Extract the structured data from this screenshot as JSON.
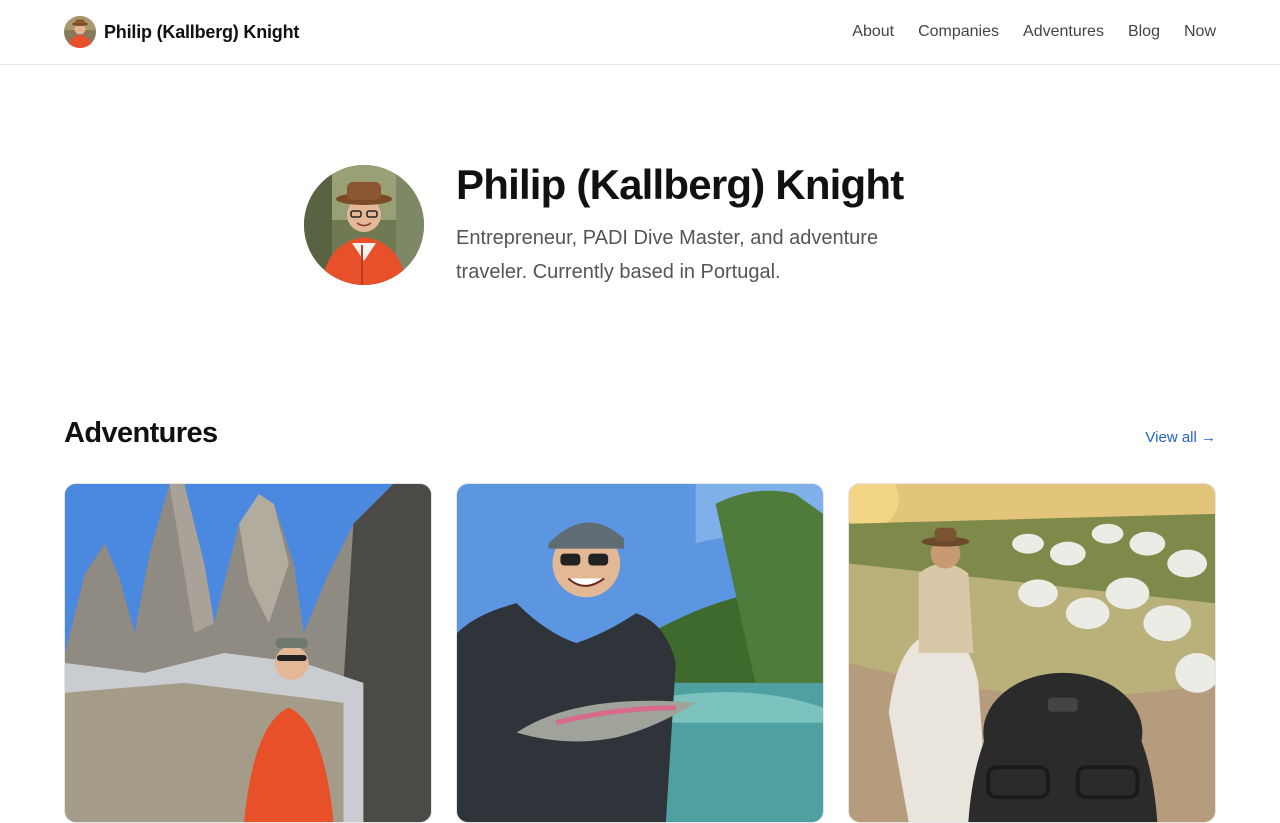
{
  "header": {
    "brand_name": "Philip (Kallberg) Knight",
    "nav": [
      {
        "label": "About"
      },
      {
        "label": "Companies"
      },
      {
        "label": "Adventures"
      },
      {
        "label": "Blog"
      },
      {
        "label": "Now"
      }
    ]
  },
  "hero": {
    "name": "Philip (Kallberg) Knight",
    "bio": "Entrepreneur, PADI Dive Master, and adventure traveler. Currently based in Portugal."
  },
  "adventures": {
    "title": "Adventures",
    "view_all": "View all →",
    "cards": [
      {
        "image": "mountain-towers-photo"
      },
      {
        "image": "fly-fishing-trout-photo"
      },
      {
        "image": "horse-cattle-drive-photo"
      }
    ]
  },
  "colors": {
    "link": "#2563c9",
    "jacket": "#e8502a",
    "text": "#111111",
    "muted": "#555555"
  }
}
